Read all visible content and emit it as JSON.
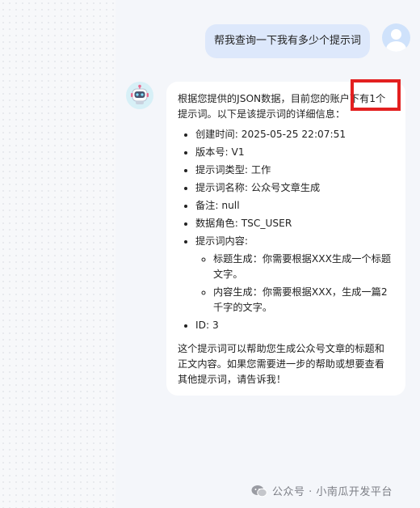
{
  "user_message": {
    "text": "帮我查询一下我有多少个提示词"
  },
  "bot_message": {
    "intro": "根据您提供的JSON数据，目前您的账户下有1个提示词。以下是该提示词的详细信息：",
    "items": {
      "created": "创建时间: 2025-05-25 22:07:51",
      "version": "版本号: V1",
      "type": "提示词类型: 工作",
      "name": "提示词名称: 公众号文章生成",
      "remark": "备注: null",
      "role": "数据角色: TSC_USER",
      "content_label": "提示词内容:",
      "sub_title": "标题生成：你需要根据XXX生成一个标题文字。",
      "sub_content": "内容生成：你需要根据XXX，生成一篇2千字的文字。",
      "id": "ID: 3"
    },
    "outro": "这个提示词可以帮助您生成公众号文章的标题和正文内容。如果您需要进一步的帮助或想要查看其他提示词，请告诉我！"
  },
  "watermark": {
    "text": "公众号 · 小南瓜开发平台"
  },
  "icons": {
    "user_avatar": "user-avatar-icon",
    "bot_avatar": "robot-avatar-icon",
    "wechat": "wechat-icon"
  },
  "colors": {
    "user_bubble": "#dde8fb",
    "highlight": "#e32020",
    "bot_avatar_bg": "#d7f0f7"
  }
}
